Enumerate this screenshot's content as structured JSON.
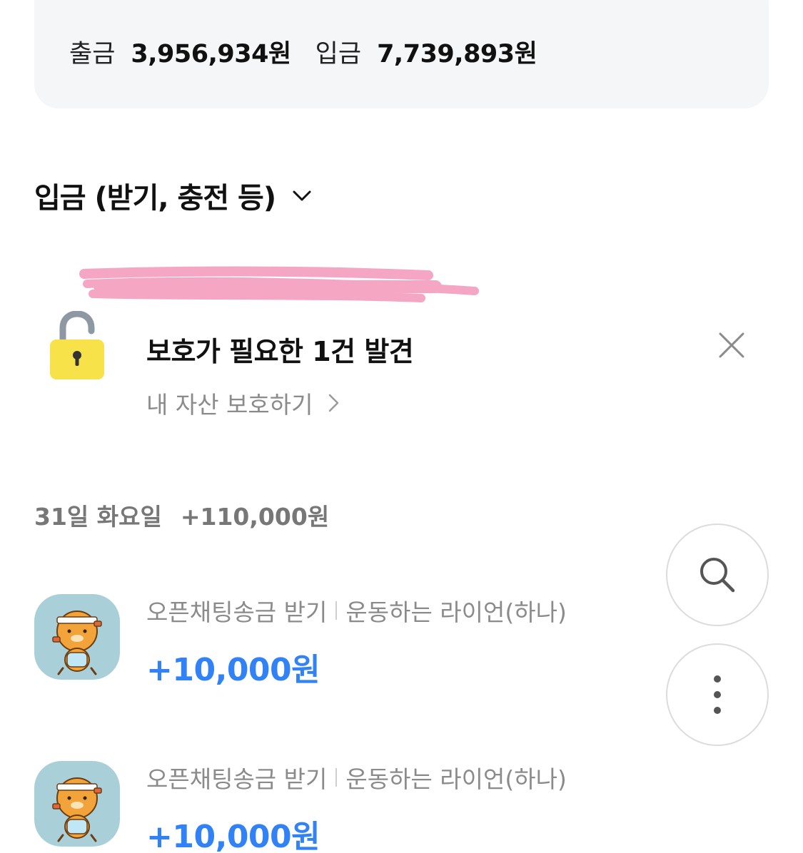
{
  "summary": {
    "withdraw_label": "출금",
    "withdraw_amount": "3,956,934원",
    "deposit_label": "입금",
    "deposit_amount": "7,739,893원"
  },
  "filter": {
    "label": "입금 (받기, 충전 등)"
  },
  "protection": {
    "title": "보호가 필요한 1건 발견",
    "link_label": "내 자산 보호하기"
  },
  "date_group": {
    "date_label": "31일 화요일",
    "total": "+110,000원"
  },
  "transactions": [
    {
      "type": "오픈채팅송금 받기",
      "counterparty": "운동하는 라이언(하나)",
      "amount": "+10,000원"
    },
    {
      "type": "오픈채팅송금 받기",
      "counterparty": "운동하는 라이언(하나)",
      "amount": "+10,000원"
    }
  ],
  "icons": {
    "lock": "unlocked-padlock-icon",
    "close": "close-icon",
    "search": "search-icon",
    "more": "more-vertical-icon",
    "avatar": "ryan-character-avatar"
  },
  "colors": {
    "accent_blue": "#3182f6",
    "card_bg": "#f5f6f8",
    "muted_text": "#8b8b8b",
    "lock_yellow": "#f7e24a",
    "redaction_pink": "#f4a6c2"
  }
}
